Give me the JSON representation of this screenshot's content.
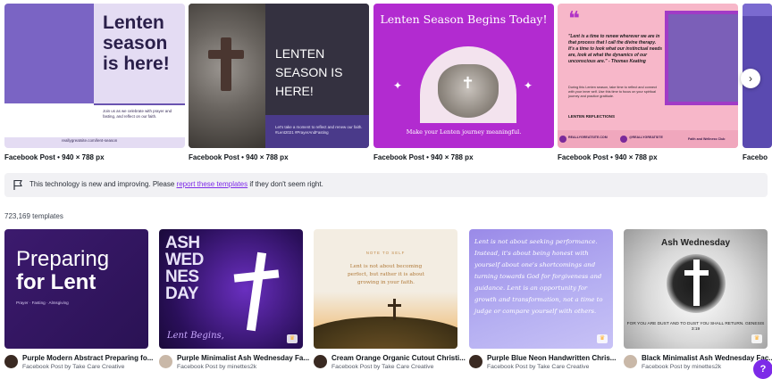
{
  "carousel": {
    "cards": [
      {
        "title": "Lenten season is here!",
        "body": "Join us as we celebrate with prayer and fasting, and reflect on our faith.",
        "url": "reallygreatsite.com/lent-season",
        "caption": "Facebook Post • 940 × 788 px"
      },
      {
        "title": "LENTEN SEASON IS HERE!",
        "body": "Let's take a moment to reflect and renew our faith. #Lent2021 #PrayerAndFasting",
        "caption": "Facebook Post • 940 × 788 px"
      },
      {
        "title": "Lenten Season Begins Today!",
        "sub": "Make your Lenten journey meaningful.",
        "caption": "Facebook Post • 940 × 788 px"
      },
      {
        "quote": "\"Lent is a time to renew wherever we are in that process that I call the divine therapy. It's a time to look what our instinctual needs are, look at what the dynamics of our unconscious are.\" - Thomas Keating",
        "body": "During this Lenten season, take time to reflect and connect with your inner self. Use this time to focus on your spiritual journey and practice gratitude.",
        "label": "LENTEN REFLECTIONS",
        "footer_1": "REALLYGREATSITE.COM",
        "footer_2": "@REALLYGREATSITE",
        "footer_3": "Faith and Wellness Club",
        "caption": "Facebook Post • 940 × 788 px"
      },
      {
        "caption": "Facebo"
      }
    ],
    "next_icon": "chevron-right-icon",
    "next_glyph": "›"
  },
  "notice": {
    "icon": "flag-icon",
    "before": "This technology is new and improving. Please ",
    "link": "report these templates",
    "after": " if they don't seem right."
  },
  "results": {
    "count": "723,169 templates"
  },
  "templates": [
    {
      "title": "Purple Modern Abstract Preparing fo...",
      "subtitle": "Facebook Post by Take Care Creative",
      "art": {
        "line1": "Preparing",
        "line2": "for Lent",
        "sub": "Prayer · Fasting · Almsgiving"
      },
      "avatar_color": "#3a2a22"
    },
    {
      "title": "Purple Minimalist Ash Wednesday Fa...",
      "subtitle": "Facebook Post by minettes2k",
      "art": {
        "stack": "ASH WED NES DAY",
        "script": "Lent Begins,"
      },
      "avatar_color": "#c9b8a8",
      "premium": true
    },
    {
      "title": "Cream Orange Organic Cutout Christi...",
      "subtitle": "Facebook Post by Take Care Creative",
      "art": {
        "note": "NOTE TO SELF",
        "text": "Lent is not about becoming perfect, but rather it is about growing in your faith."
      },
      "avatar_color": "#3a2a22"
    },
    {
      "title": "Purple Blue Neon Handwritten Chris...",
      "subtitle": "Facebook Post by Take Care Creative",
      "art": {
        "text": "Lent is not about seeking performance. Instead, it's about being honest with yourself about one's shortcomings and turning towards God for forgiveness and guidance. Lent is an opportunity for growth and transformation, not a time to judge or compare yourself with others."
      },
      "avatar_color": "#3a2a22",
      "premium": true
    },
    {
      "title": "Black Minimalist Ash Wednesday Fac...",
      "subtitle": "Facebook Post by minettes2k",
      "art": {
        "title": "Ash Wednesday",
        "sub": "FOR YOU ARE DUST AND TO DUST YOU SHALL RETURN. GENESIS 3:19"
      },
      "avatar_color": "#c9b8a8",
      "premium": true
    }
  ],
  "crown_glyph": "♛",
  "help_glyph": "?"
}
